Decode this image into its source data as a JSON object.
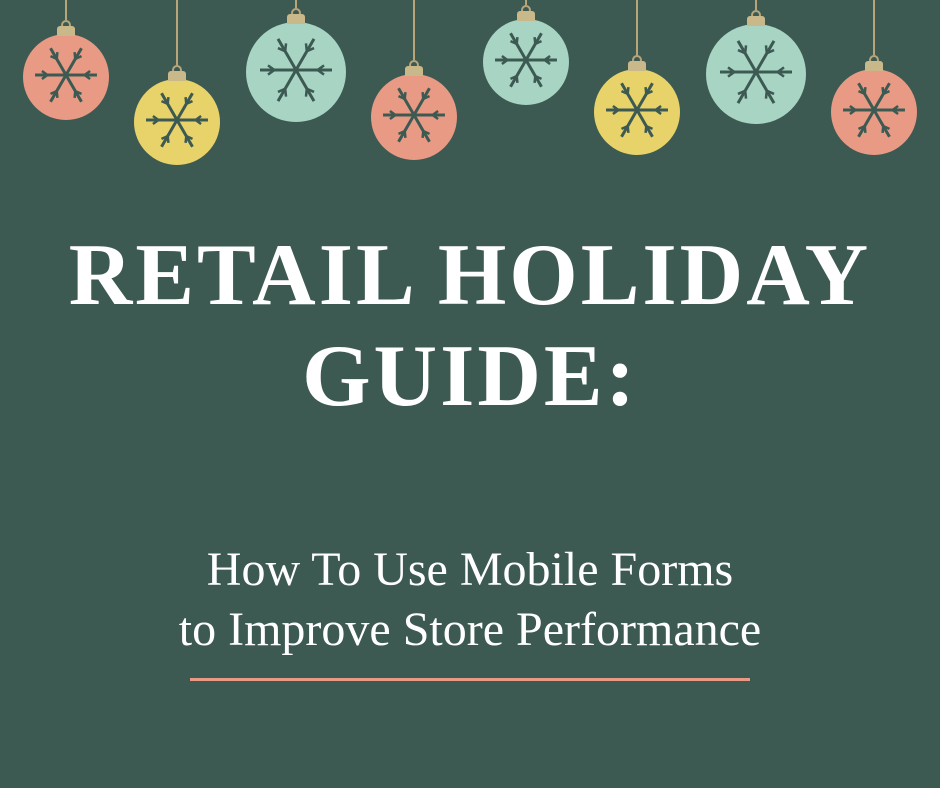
{
  "title": "RETAIL HOLIDAY GUIDE:",
  "subtitle_line1": "How To Use Mobile Forms",
  "subtitle_line2": "to Improve Store Performance",
  "ornaments": [
    {
      "color": "coral",
      "string_height": 20,
      "size": 86
    },
    {
      "color": "yellow",
      "string_height": 65,
      "size": 86
    },
    {
      "color": "mint",
      "string_height": 8,
      "size": 100
    },
    {
      "color": "coral",
      "string_height": 60,
      "size": 86
    },
    {
      "color": "mint",
      "string_height": 5,
      "size": 86
    },
    {
      "color": "yellow",
      "string_height": 55,
      "size": 86
    },
    {
      "color": "mint",
      "string_height": 10,
      "size": 100
    },
    {
      "color": "coral",
      "string_height": 55,
      "size": 86
    }
  ],
  "colors": {
    "background": "#3d5a52",
    "coral": "#e89a85",
    "yellow": "#e8d36b",
    "mint": "#a8d4c4",
    "snowflake": "#3d5a52"
  }
}
